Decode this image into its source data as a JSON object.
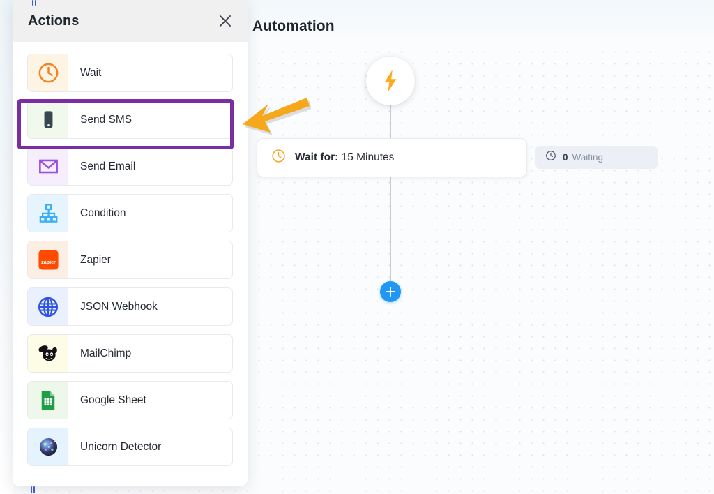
{
  "canvas": {
    "title": "Automation",
    "trigger": {
      "icon": "lightning-bolt-icon"
    },
    "wait_card": {
      "icon": "clock-icon",
      "label": "Wait for:",
      "value": "15 Minutes"
    },
    "waiting_badge": {
      "icon": "clock-icon",
      "count": "0",
      "label": "Waiting"
    },
    "add_button": {
      "icon": "plus-icon"
    },
    "colors": {
      "accent_blue": "#2196f3",
      "bolt_orange": "#f9a825",
      "badge_bg": "#eceff6"
    }
  },
  "panel": {
    "title": "Actions",
    "close_icon": "close-icon",
    "items": [
      {
        "label": "Wait",
        "icon": "clock-icon",
        "icon_bg": "#fdf4e3",
        "icon_color": "#f58220"
      },
      {
        "label": "Send SMS",
        "icon": "phone-icon",
        "icon_bg": "#f1f8ec",
        "icon_color": "#37474f"
      },
      {
        "label": "Send Email",
        "icon": "envelope-icon",
        "icon_bg": "#f6eefc",
        "icon_color": "#9c4fe0"
      },
      {
        "label": "Condition",
        "icon": "sitemap-icon",
        "icon_bg": "#e6f5fd",
        "icon_color": "#3bb0f5"
      },
      {
        "label": "Zapier",
        "icon": "zapier-icon",
        "icon_bg": "#fdeee3",
        "icon_color": "#ff4a00"
      },
      {
        "label": "JSON Webhook",
        "icon": "globe-icon",
        "icon_bg": "#eaf0fd",
        "icon_color": "#2f55e0"
      },
      {
        "label": "MailChimp",
        "icon": "mailchimp-icon",
        "icon_bg": "#fdfce6",
        "icon_color": "#1a1a1a"
      },
      {
        "label": "Google Sheet",
        "icon": "google-sheet-icon",
        "icon_bg": "#eef8ea",
        "icon_color": "#1e9e45"
      },
      {
        "label": "Unicorn Detector",
        "icon": "unicorn-icon",
        "icon_bg": "#e4f3fd",
        "icon_color": "#3a3a6a"
      }
    ]
  },
  "annotations": {
    "highlight": {
      "target": "Send SMS",
      "color": "#7b2ea3"
    },
    "arrow": {
      "direction": "left",
      "color": "#f5a81c",
      "points_to": "Send SMS"
    }
  }
}
